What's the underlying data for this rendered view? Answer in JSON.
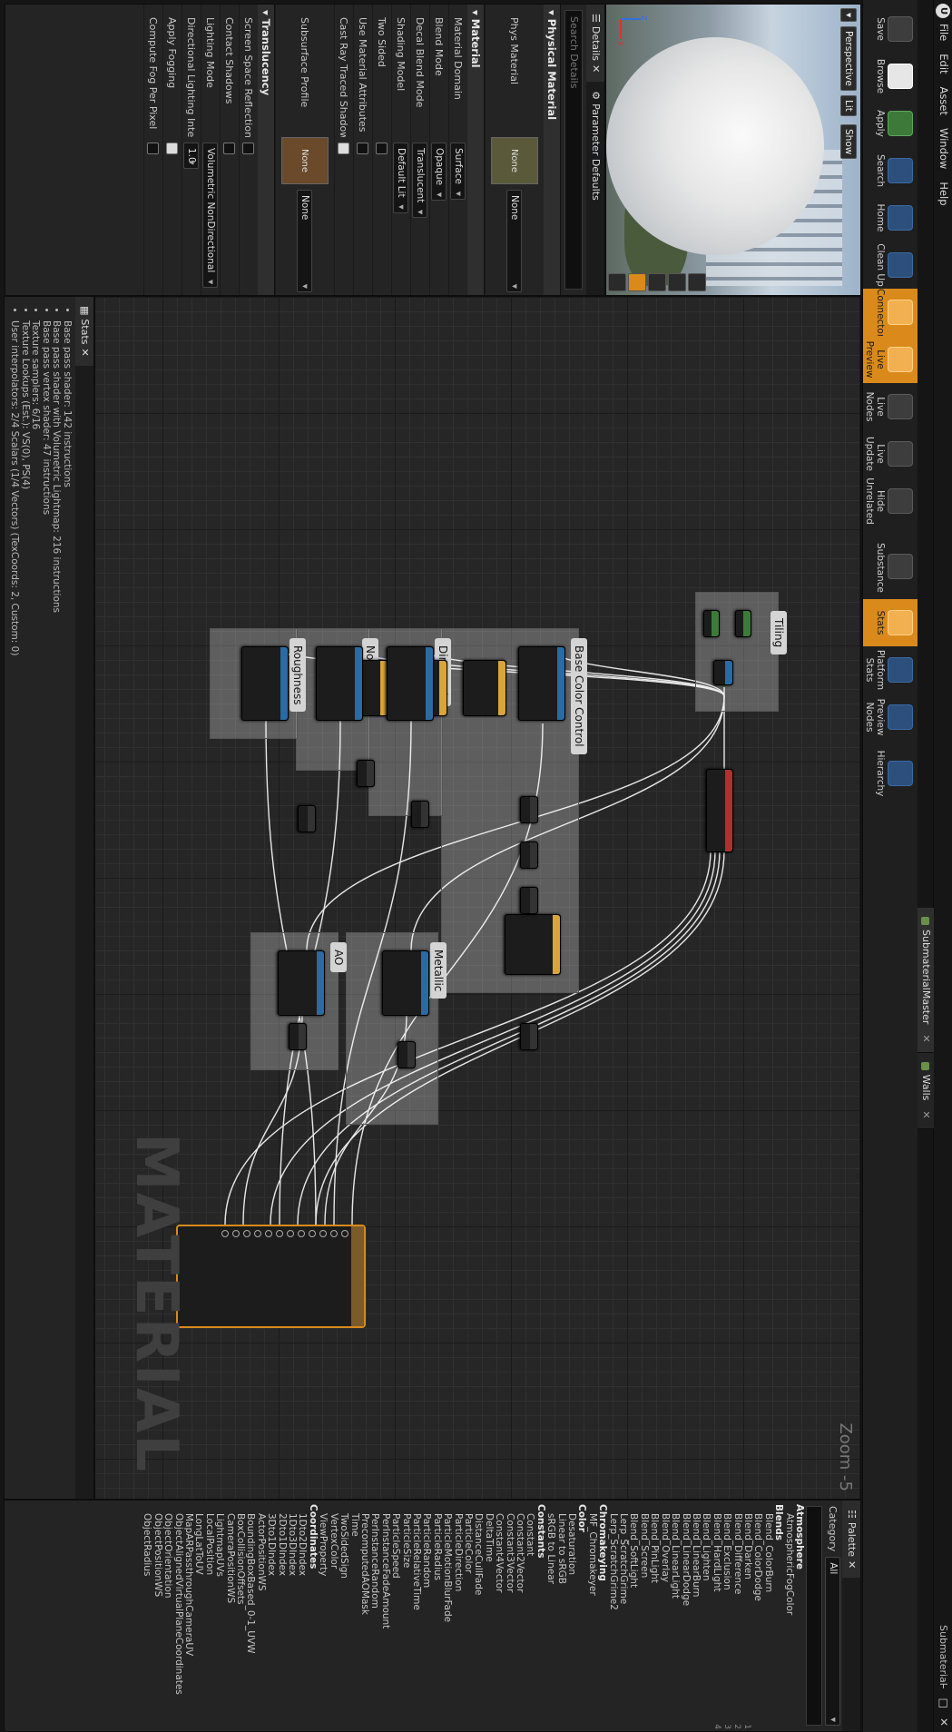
{
  "app": {
    "name": "Submaterial"
  },
  "menu": [
    "File",
    "Edit",
    "Asset",
    "Window",
    "Help"
  ],
  "tabs": [
    {
      "label": "SubmaterialMaster",
      "active": true
    },
    {
      "label": "Walls",
      "active": false
    }
  ],
  "toolbar": {
    "items": [
      {
        "label": "Save",
        "icon": "save-icon"
      },
      {
        "label": "Browse",
        "icon": "browse-icon"
      },
      {
        "label": "Apply",
        "icon": "apply-icon"
      },
      {
        "label": "Search",
        "icon": "search-icon"
      },
      {
        "label": "Home",
        "icon": "home-icon"
      },
      {
        "label": "Clean Up",
        "icon": "clean-up-icon"
      },
      {
        "label": "Connectors",
        "icon": "connectors-icon",
        "active": true
      },
      {
        "label": "Live Preview",
        "icon": "live-preview-icon",
        "active": true
      },
      {
        "label": "Live Nodes",
        "icon": "live-nodes-icon"
      },
      {
        "label": "Live Update",
        "icon": "live-update-icon"
      },
      {
        "label": "Hide Unrelated",
        "icon": "hide-unrelated-icon"
      },
      {
        "label": "Substance",
        "icon": "substance-icon"
      },
      {
        "label": "Stats",
        "icon": "stats-icon",
        "active": true
      },
      {
        "label": "Platform Stats",
        "icon": "platform-stats-icon"
      },
      {
        "label": "Preview Nodes",
        "icon": "preview-nodes-icon"
      },
      {
        "label": "Hierarchy",
        "icon": "hierarchy-icon"
      }
    ]
  },
  "viewport": {
    "perspective": "Perspective",
    "lit": "Lit",
    "show": "Show"
  },
  "details": {
    "tab_details": "Details",
    "tab_params": "Parameter Defaults",
    "search_placeholder": "Search Details",
    "physical_header": "Physical Material",
    "phys_label": "Phys Material",
    "phys_value": "None",
    "phys_thumb": "None",
    "material_header": "Material",
    "rows": [
      {
        "label": "Material Domain",
        "value": "Surface",
        "type": "dropdown"
      },
      {
        "label": "Blend Mode",
        "value": "Opaque",
        "type": "dropdown"
      },
      {
        "label": "Decal Blend Mode",
        "value": "Translucent",
        "type": "dropdown"
      },
      {
        "label": "Shading Model",
        "value": "Default Lit",
        "type": "dropdown"
      },
      {
        "label": "Two Sided",
        "value": "",
        "type": "checkbox",
        "checked": false
      },
      {
        "label": "Use Material Attributes",
        "value": "",
        "type": "checkbox",
        "checked": false
      },
      {
        "label": "Cast Ray Traced Shadows",
        "value": "",
        "type": "checkbox",
        "checked": true
      }
    ],
    "subsurface_label": "Subsurface Profile",
    "subsurface_value": "None",
    "subsurface_thumb": "None",
    "translucency_header": "Translucency",
    "trans_rows": [
      {
        "label": "Screen Space Reflections",
        "type": "checkbox",
        "checked": false,
        "value": ""
      },
      {
        "label": "Contact Shadows",
        "type": "checkbox",
        "checked": false,
        "value": ""
      },
      {
        "label": "Lighting Mode",
        "type": "dropdown",
        "value": "Volumetric NonDirectional"
      },
      {
        "label": "Directional Lighting Inten",
        "type": "number",
        "value": "1.0"
      },
      {
        "label": "Apply Fogging",
        "type": "checkbox",
        "checked": true,
        "value": ""
      },
      {
        "label": "Compute Fog Per Pixel",
        "type": "checkbox",
        "checked": false,
        "value": ""
      }
    ]
  },
  "graph": {
    "zoom": "Zoom -5",
    "watermark": "MATERIAL",
    "comments": [
      {
        "title": "Tiling"
      },
      {
        "title": "Base Color Control"
      },
      {
        "title": "Dirt_Mask"
      },
      {
        "title": "Normal"
      },
      {
        "title": "Roughness"
      },
      {
        "title": "Metallic"
      },
      {
        "title": "AO"
      }
    ]
  },
  "stats": {
    "title": "Stats",
    "lines": [
      "Base pass shader: 142 instructions",
      "Base pass shader with Volumetric Lightmap: 216 instructions",
      "Base pass vertex shader: 47 instructions",
      "Texture samplers: 6/16",
      "Texture Lookups (Est.): VS(0), PS(4)",
      "User interpolators: 2/4 Scalars (1/4 Vectors) (TexCoords: 2, Custom: 0)"
    ]
  },
  "palette": {
    "title": "Palette",
    "category_label": "Category",
    "category_value": "All",
    "groups": [
      {
        "header": "Atmosphere",
        "items": [
          "AtmosphericFogColor"
        ]
      },
      {
        "header": "Blends",
        "items": [
          "Blend_ColorBurn",
          "Blend_ColorDodge",
          "Blend_Darken",
          "Blend_Difference",
          "Blend_Exclusion",
          "Blend_HardLight",
          "Blend_Lighten",
          "Blend_LinearBurn",
          "Blend_LinearDodge",
          "Blend_LinearLight",
          "Blend_Overlay",
          "Blend_PinLight",
          "Blend_Screen",
          "Blend_SoftLight",
          "Lerp_ScratchGrime",
          "Lerp_ScratchGrime2"
        ]
      },
      {
        "header": "Chromakeying",
        "items": [
          "MF_Chromakeyer"
        ]
      },
      {
        "header": "Color",
        "items": [
          "Desaturation",
          "Linear to sRGB",
          "sRGB to Linear"
        ]
      },
      {
        "header": "Constants",
        "items": [
          "Constant",
          "Constant2Vector",
          "Constant3Vector",
          "Constant4Vector",
          "DeltaTime",
          "DistanceCullFade",
          "ParticleColor",
          "ParticleDirection",
          "ParticleMotionBlurFade",
          "ParticleRadius",
          "ParticleRandom",
          "ParticleRelativeTime",
          "ParticleSize",
          "ParticleSpeed",
          "PerInstanceFadeAmount",
          "PerInstanceRandom",
          "PrecomputedAOMask",
          "Time",
          "TwoSidedSign",
          "VertexColor",
          "ViewProperty"
        ]
      },
      {
        "header": "Coordinates",
        "items": [
          "1Dto2DIndex",
          "1Dto3DIndex",
          "2Dto1DIndex",
          "3Dto1DIndex",
          "ActorPositionWS",
          "BoundingBoxBased_0-1_UVW",
          "BoxCollisionOffsets",
          "CameraPositionWS",
          "LightmapUVs",
          "LocalPosition",
          "LongLatToUV",
          "MapARPassthroughCameraUV",
          "ObjectAlignedVirtualPlaneCoordinates",
          "ObjectOrientation",
          "ObjectPositionWS",
          "ObjectRadius"
        ]
      }
    ],
    "row_numbers": [
      "1",
      "2",
      "3",
      "4"
    ]
  },
  "colors": {
    "accent_orange": "#d98a1b",
    "node_header_param": "#2a6aa5",
    "node_header_texture": "#2a6aa5",
    "output_border": "#d98a1b"
  }
}
